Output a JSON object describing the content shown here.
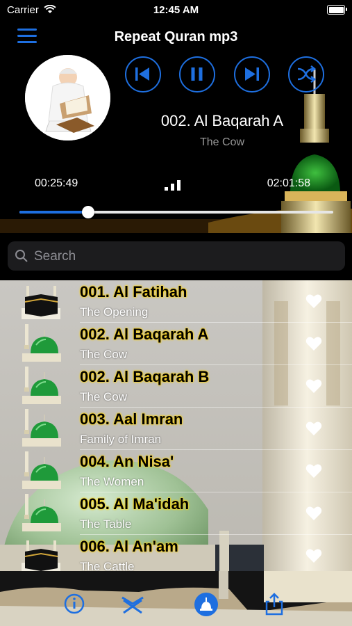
{
  "status": {
    "carrier": "Carrier",
    "time": "12:45 AM",
    "battery_level": 1.0
  },
  "header": {
    "title": "Repeat Quran mp3"
  },
  "now_playing": {
    "title": "002. Al Baqarah A",
    "subtitle": "The Cow",
    "elapsed": "00:25:49",
    "total": "02:01:58",
    "progress": 0.218
  },
  "search": {
    "placeholder": "Search"
  },
  "list": [
    {
      "name": "001. Al Fatihah",
      "subtitle": "The Opening",
      "thumb": "kaaba-icon"
    },
    {
      "name": "002. Al Baqarah A",
      "subtitle": "The Cow",
      "thumb": "green-dome-icon"
    },
    {
      "name": "002. Al Baqarah B",
      "subtitle": "The Cow",
      "thumb": "green-dome-icon"
    },
    {
      "name": "003. Aal Imran",
      "subtitle": "Family of Imran",
      "thumb": "green-dome-icon"
    },
    {
      "name": "004. An Nisa'",
      "subtitle": "The Women",
      "thumb": "green-dome-icon"
    },
    {
      "name": "005. Al Ma'idah",
      "subtitle": "The Table",
      "thumb": "green-dome-icon"
    },
    {
      "name": "006. Al An'am",
      "subtitle": "The Cattle",
      "thumb": "kaaba-icon"
    }
  ],
  "colors": {
    "accent": "#1e6fe0",
    "title_glow": "#ffd200"
  },
  "tabs": [
    "info-icon",
    "quran-stand-icon",
    "home-dome-icon",
    "share-icon"
  ]
}
